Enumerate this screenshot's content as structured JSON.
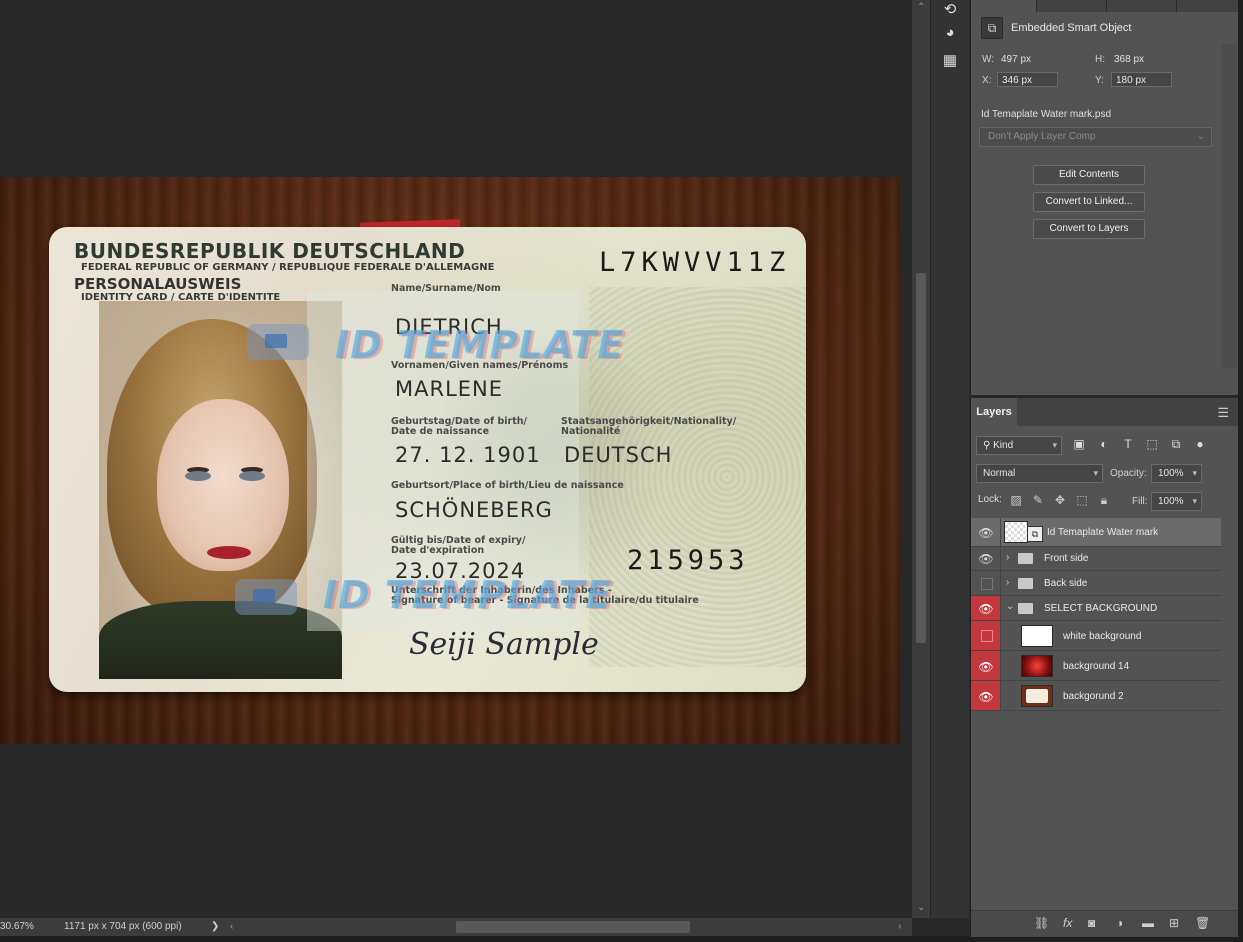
{
  "canvas": {
    "card": {
      "title": "BUNDESREPUBLIK DEUTSCHLAND",
      "subtitle": "FEDERAL REPUBLIC OF GERMANY / REPUBLIQUE FEDERALE D'ALLEMAGNE",
      "doc_type": "PERSONALAUSWEIS",
      "doc_type_sub": "IDENTITY CARD / CARTE D'IDENTITE",
      "doc_number": "L7KWVV11Z",
      "surname_label": "Name/Surname/Nom",
      "surname": "DIETRICH",
      "given_label": "Vornamen/Given names/Prénoms",
      "given": "MARLENE",
      "dob_label_1": "Geburtstag/Date of birth/",
      "dob_label_2": "Date de naissance",
      "dob": "27. 12. 1901",
      "nationality_label_1": "Staatsangehörigkeit/Nationality/",
      "nationality_label_2": "Nationalité",
      "nationality": "DEUTSCH",
      "pob_label": "Geburtsort/Place of birth/Lieu de naissance",
      "pob": "SCHÖNEBERG",
      "expiry_label_1": "Gültig bis/Date of expiry/",
      "expiry_label_2": "Date d'expiration",
      "expiry": "23.07.2024",
      "can_number": "215953",
      "signature_label_1": "Unterschrift der Inhaberin/des Inhabers -",
      "signature_label_2": "Signature of bearer - Signature de la titulaire/du titulaire",
      "signature": "Seiji Sample",
      "watermark_text": "ID TEMPLATE"
    }
  },
  "status_bar": {
    "zoom": "30.67%",
    "doc_info": "1171 px x 704 px (600 ppi)",
    "arrow": "❯"
  },
  "properties": {
    "header": "Embedded Smart Object",
    "w_label": "W:",
    "w_value": "497 px",
    "h_label": "H:",
    "h_value": "368 px",
    "x_label": "X:",
    "x_value": "346 px",
    "y_label": "Y:",
    "y_value": "180 px",
    "file_name": "Id Temaplate Water mark.psd",
    "layer_comp_placeholder": "Don't Apply Layer Comp",
    "buttons": [
      "Edit Contents",
      "Convert to Linked...",
      "Convert to Layers"
    ]
  },
  "layers_panel": {
    "tab": "Layers",
    "filter_kind": "Kind",
    "blend_mode": "Normal",
    "opacity_label": "Opacity:",
    "opacity_value": "100%",
    "lock_label": "Lock:",
    "fill_label": "Fill:",
    "fill_value": "100%",
    "layers": [
      {
        "name": "Id Temaplate Water mark",
        "visible": true,
        "selected": true,
        "type": "smart-object"
      },
      {
        "name": "Front side",
        "visible": true,
        "type": "group"
      },
      {
        "name": "Back side",
        "visible": false,
        "type": "group"
      },
      {
        "name": "SELECT BACKGROUND",
        "visible": true,
        "type": "group-open"
      },
      {
        "name": "white background",
        "visible": false,
        "type": "layer"
      },
      {
        "name": "background 14",
        "visible": true,
        "type": "layer"
      },
      {
        "name": "backgorund 2",
        "visible": true,
        "type": "layer"
      }
    ]
  },
  "colors": {
    "accent_red": "#c2383c",
    "panel_bg": "#535353",
    "app_bg": "#282828"
  }
}
